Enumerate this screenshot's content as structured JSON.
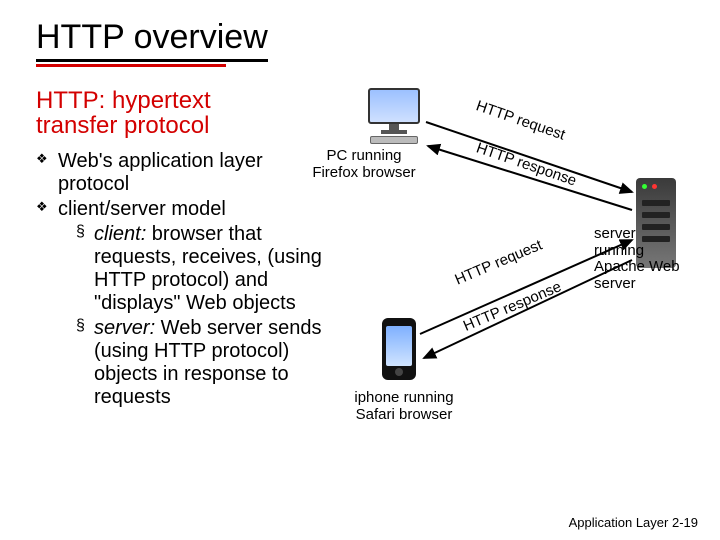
{
  "title": "HTTP overview",
  "subhead_line1": "HTTP: hypertext",
  "subhead_line2": "transfer protocol",
  "bullets": {
    "b0": "Web's application layer protocol",
    "b1": "client/server model",
    "s0_prefix": "client:",
    "s0_rest": " browser that requests, receives, (using HTTP protocol) and \"displays\" Web objects",
    "s1_prefix": "server:",
    "s1_rest": " Web server sends (using HTTP protocol) objects in response to requests"
  },
  "diagram": {
    "pc_label_l1": "PC running",
    "pc_label_l2": "Firefox browser",
    "phone_label_l1": "iphone running",
    "phone_label_l2": "Safari browser",
    "server_label_l1": "server",
    "server_label_l2": "running",
    "server_label_l3": "Apache Web",
    "server_label_l4": "server",
    "arrow_req": "HTTP request",
    "arrow_resp": "HTTP response"
  },
  "footer_text": "Application Layer",
  "footer_page": "2-19"
}
